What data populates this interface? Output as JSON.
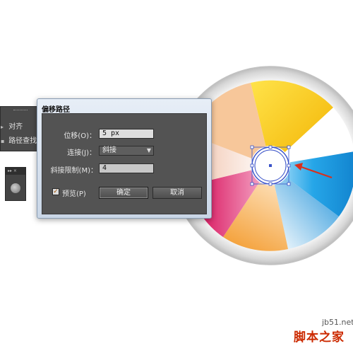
{
  "side_panel": {
    "items": [
      {
        "icon": "align-icon",
        "label": "对齐"
      },
      {
        "icon": "pathfinder-icon",
        "label": "路径查找器"
      }
    ]
  },
  "dialog": {
    "title": "偏移路径",
    "offset_label": "位移(O)：",
    "offset_value": "5 px",
    "joins_label": "连接(J)：",
    "joins_value": "斜接",
    "miter_label": "斜接限制(M)：",
    "miter_value": "4",
    "preview_label": "预览(P)",
    "preview_checked": true,
    "ok_label": "确定",
    "cancel_label": "取消"
  },
  "watermark": {
    "site": "jb51.net",
    "name": "脚本之家"
  },
  "colors": {
    "yellow": "#f6c400",
    "orange": "#f6a64a",
    "blue": "#1a9be0",
    "magenta": "#d6196a",
    "arrow": "#d8301d"
  }
}
